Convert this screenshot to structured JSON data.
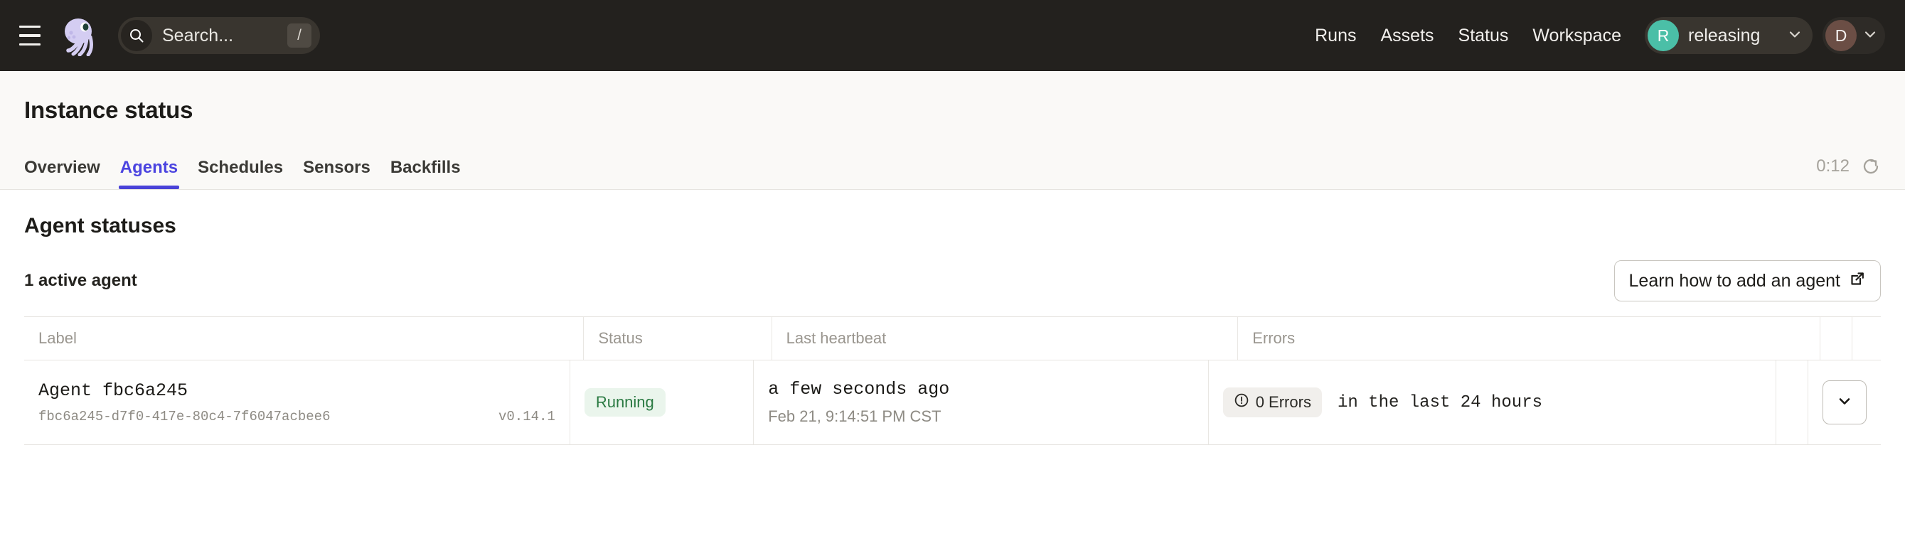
{
  "topnav": {
    "menu_label": "menu",
    "logo_label": "Dagster",
    "search": {
      "placeholder": "Search...",
      "shortcut_key": "/"
    },
    "links": [
      {
        "label": "Runs"
      },
      {
        "label": "Assets"
      },
      {
        "label": "Status"
      },
      {
        "label": "Workspace"
      }
    ],
    "deployment": {
      "initial": "R",
      "name": "releasing",
      "avatar_color": "#4bbfa7"
    },
    "user": {
      "initial": "D",
      "avatar_color": "#6b4e45"
    },
    "background_color": "#23211e"
  },
  "page": {
    "title": "Instance status",
    "tabs": [
      {
        "label": "Overview",
        "active": false
      },
      {
        "label": "Agents",
        "active": true
      },
      {
        "label": "Schedules",
        "active": false
      },
      {
        "label": "Sensors",
        "active": false
      },
      {
        "label": "Backfills",
        "active": false
      }
    ],
    "active_tab_color": "#4b44e0",
    "refresh": {
      "timer": "0:12",
      "icon": "refresh-icon"
    }
  },
  "main": {
    "section_title": "Agent statuses",
    "active_count": "1 active agent",
    "learn_button": "Learn how to add an agent",
    "table": {
      "columns": [
        "Label",
        "Status",
        "Last heartbeat",
        "Errors",
        ""
      ],
      "rows": [
        {
          "label": "Agent fbc6a245",
          "agent_id": "fbc6a245-d7f0-417e-80c4-7f6047acbee6",
          "version": "v0.14.1",
          "status": "Running",
          "status_color": "#2a7a42",
          "heartbeat_relative": "a few seconds ago",
          "heartbeat_absolute": "Feb 21, 9:14:51 PM CST",
          "errors_badge": "0 Errors",
          "errors_note": "in the last 24 hours"
        }
      ]
    }
  }
}
